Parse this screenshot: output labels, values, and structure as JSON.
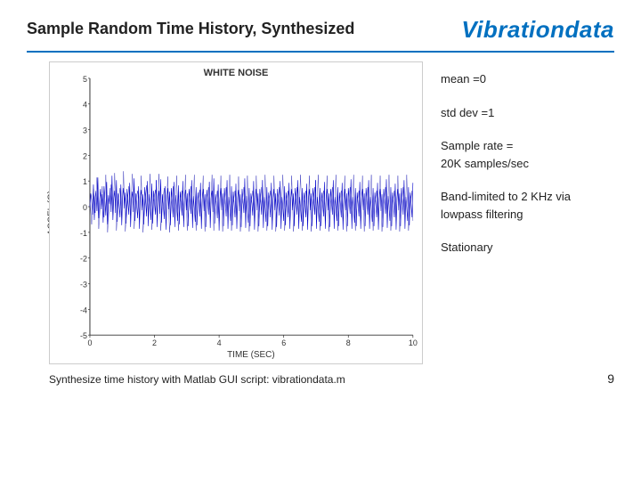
{
  "header": {
    "title": "Sample Random Time History, Synthesized",
    "brand": "Vibrationdata"
  },
  "divider_color": "#0070c0",
  "chart": {
    "title": "WHITE NOISE",
    "y_axis_label": "ACCEL (G)",
    "x_axis_label": "TIME (SEC)",
    "y_ticks": [
      "5",
      "4",
      "3",
      "2",
      "1",
      "0",
      "-1",
      "-2",
      "-3",
      "-4",
      "-5"
    ],
    "x_ticks": [
      "0",
      "2",
      "4",
      "6",
      "8",
      "10"
    ]
  },
  "info": {
    "mean": "mean =0",
    "std_dev": "std dev =1",
    "sample_rate": "Sample rate =\n  20K samples/sec",
    "band_limited": "Band-limited to 2 KHz via\nlowpass filtering",
    "stationary": "Stationary"
  },
  "footer": {
    "script_text": "Synthesize time history with Matlab GUI script:  vibrationdata.m",
    "page_number": "9"
  }
}
